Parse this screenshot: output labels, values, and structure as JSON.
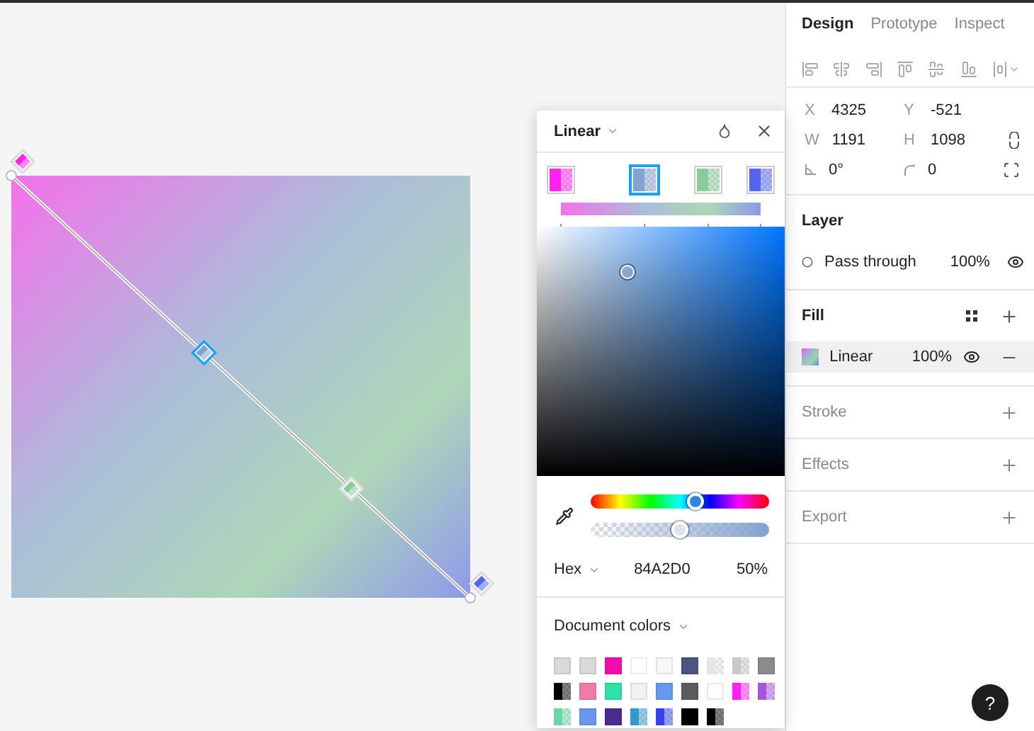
{
  "canvas": {
    "stops": [
      {
        "color": "#ff22ee",
        "level": 0,
        "selected": false
      },
      {
        "color": "#84a2d0",
        "level": 0.42,
        "selected": true
      },
      {
        "color": "#88cc99",
        "level": 0.74,
        "selected": false
      },
      {
        "color": "#5566ee",
        "level": 1,
        "selected": false
      }
    ]
  },
  "picker": {
    "type": "Linear",
    "hue": {
      "level": 0.59
    },
    "opacity": {
      "level": 0.5
    },
    "format": "Hex",
    "value": "84A2D0",
    "alpha": "50%",
    "library": "Document colors",
    "swatches": [
      {
        "color": "#d9d9d9",
        "kind": "solid"
      },
      {
        "color": "#d9d9d9",
        "kind": "solid"
      },
      {
        "color": "#f20cb0",
        "kind": "solid"
      },
      {
        "color": "#ffffff",
        "kind": "solid"
      },
      {
        "color": "#f7f7f7",
        "kind": "solid"
      },
      {
        "color": "#4a5580",
        "kind": "solid"
      },
      {
        "color": "#e6e6e6",
        "kind": "translucent"
      },
      {
        "color": "#c8c8c8",
        "kind": "translucent"
      },
      {
        "color": "#8c8c8c",
        "kind": "solid"
      },
      {
        "color": "#000000",
        "kind": "translucent"
      },
      {
        "color": "#f07aa8",
        "kind": "solid"
      },
      {
        "color": "#2de3a6",
        "kind": "solid"
      },
      {
        "color": "#f2f2f2",
        "kind": "solid"
      },
      {
        "color": "#6699ee",
        "kind": "solid"
      },
      {
        "color": "#5c5c5c",
        "kind": "solid"
      },
      {
        "color": "#fdfdfd",
        "kind": "solid"
      },
      {
        "color": "#ff22ee",
        "kind": "translucent"
      },
      {
        "color": "#a855dd",
        "kind": "translucent"
      },
      {
        "color": "#6fd4a4",
        "kind": "translucent"
      },
      {
        "color": "#6699ee",
        "kind": "solid"
      },
      {
        "color": "#4a2a90",
        "kind": "solid"
      },
      {
        "color": "#3399cc",
        "kind": "translucent"
      },
      {
        "color": "#3344ee",
        "kind": "translucent"
      },
      {
        "color": "#000000",
        "kind": "solid"
      },
      {
        "color": "#000000",
        "kind": "translucent"
      }
    ]
  },
  "panel": {
    "tabs": [
      {
        "label": "Design",
        "selected": true
      },
      {
        "label": "Prototype",
        "selected": false
      },
      {
        "label": "Inspect",
        "selected": false
      }
    ],
    "position": [
      {
        "label": "X",
        "value": "4325"
      },
      {
        "label": "Y",
        "value": "-521"
      }
    ],
    "size": [
      {
        "label": "W",
        "value": "1191"
      },
      {
        "label": "H",
        "value": "1098"
      }
    ],
    "rotation": "0°",
    "radius": "0",
    "layer": {
      "title": "Layer",
      "blend": "Pass through",
      "opacity": "100%"
    },
    "fill": {
      "title": "Fill",
      "items": [
        {
          "type": "Linear",
          "opacity": "100%"
        }
      ]
    },
    "sections": [
      "Stroke",
      "Effects",
      "Export"
    ]
  },
  "help": "?"
}
